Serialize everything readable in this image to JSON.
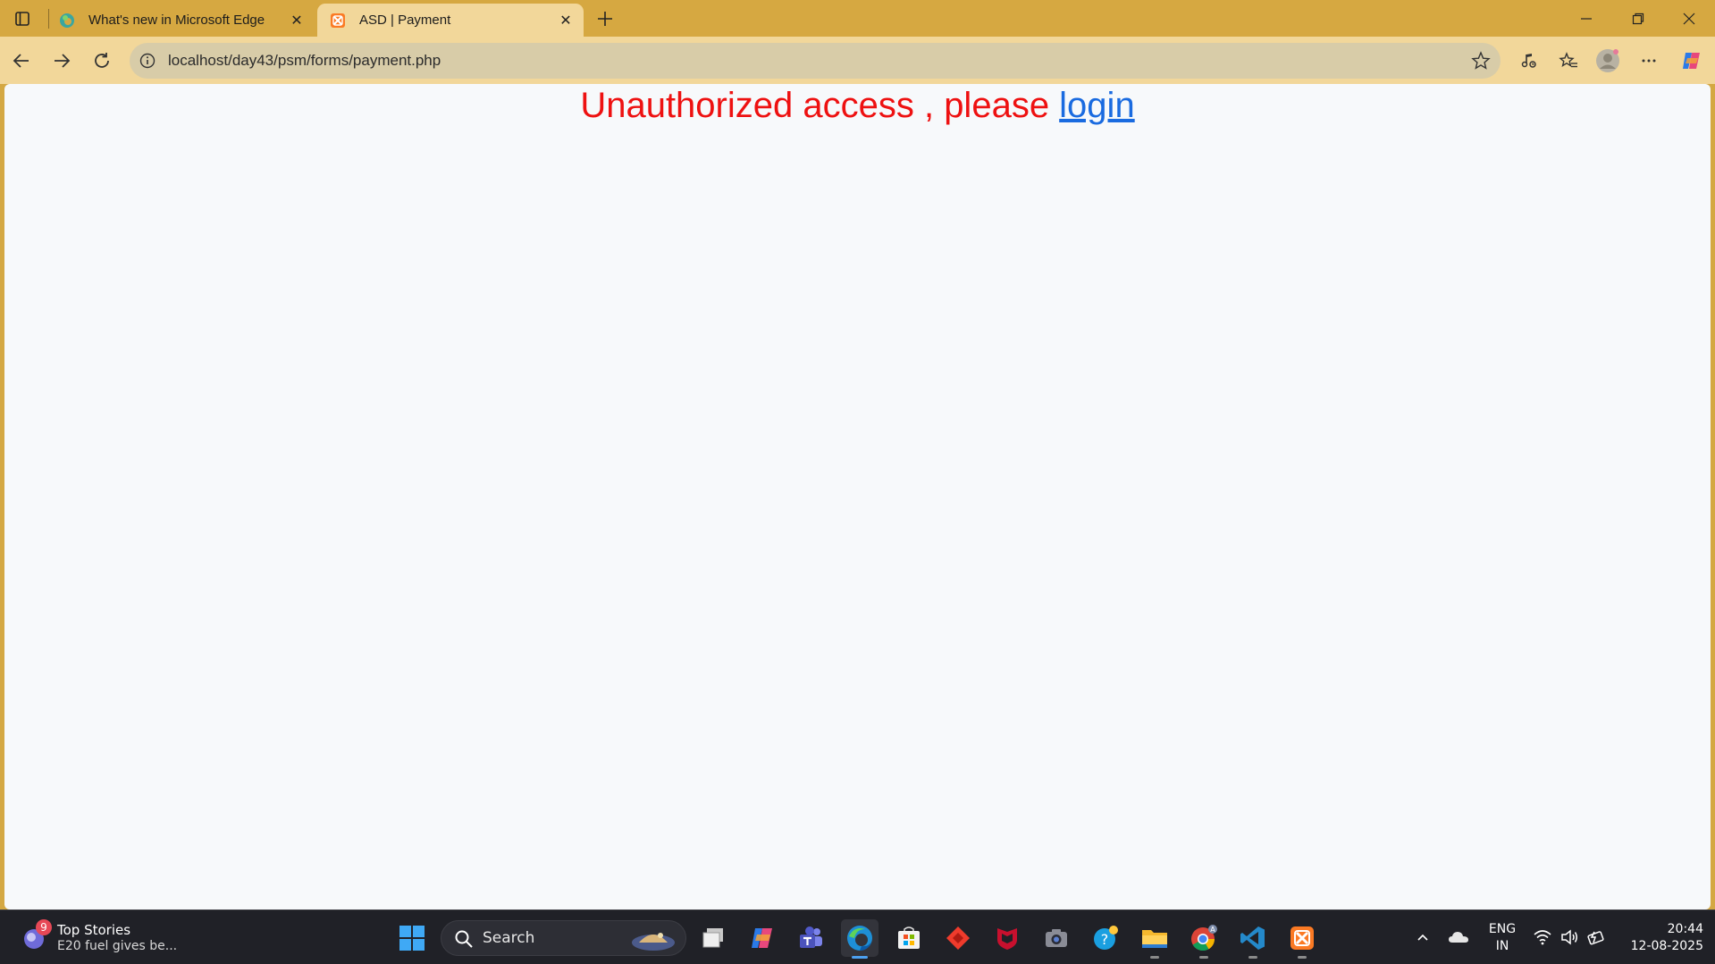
{
  "browser": {
    "tabs": [
      {
        "title": "What's new in Microsoft Edge",
        "icon": "edge-icon"
      },
      {
        "title": "ASD | Payment",
        "icon": "xampp-icon",
        "active": true
      }
    ],
    "address": "localhost/day43/psm/forms/payment.php"
  },
  "page": {
    "message_prefix": "Unauthorized access , please ",
    "login_link": "login",
    "message_color": "#ee1111",
    "link_color": "#1a6be0"
  },
  "taskbar": {
    "widget_title": "Top Stories",
    "widget_subtitle": "E20 fuel gives be...",
    "widget_badge": "9",
    "search_label": "Search",
    "language": "ENG",
    "region": "IN",
    "time": "20:44",
    "date": "12-08-2025"
  },
  "colors": {
    "titlebar": "#d6a841",
    "toolbar": "#f2d79a",
    "taskbar": "#202127"
  }
}
